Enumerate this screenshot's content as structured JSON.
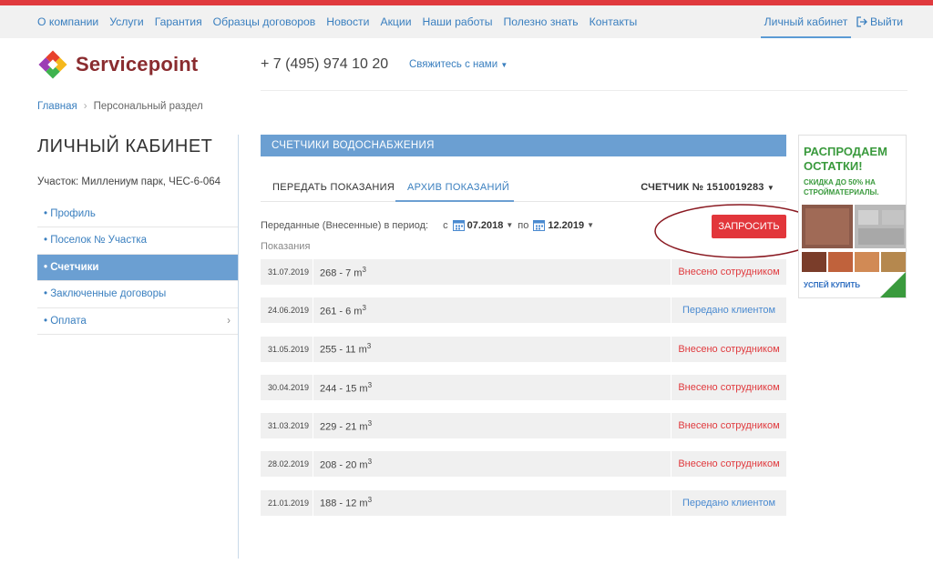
{
  "top_nav": [
    "О компании",
    "Услуги",
    "Гарантия",
    "Образцы договоров",
    "Новости",
    "Акции",
    "Наши работы",
    "Полезно знать",
    "Контакты"
  ],
  "account": {
    "cabinet_label": "Личный кабинет",
    "logout_label": "Выйти"
  },
  "brand": {
    "name": "Servicepoint",
    "phone": "+ 7 (495) 974 10 20",
    "contact_label": "Свяжитесь с нами"
  },
  "breadcrumb": {
    "home": "Главная",
    "current": "Персональный раздел"
  },
  "page_title": "ЛИЧНЫЙ КАБИНЕТ",
  "plot": "Участок: Миллениум парк, ЧЕС-6-064",
  "sidebar": [
    {
      "label": "• Профиль"
    },
    {
      "label": "• Поселок № Участка"
    },
    {
      "label": "• Счетчики"
    },
    {
      "label": "• Заключенные договоры"
    },
    {
      "label": "• Оплата"
    }
  ],
  "section_title": "СЧЕТЧИКИ ВОДОСНАБЖЕНИЯ",
  "tabs": [
    "ПЕРЕДАТЬ ПОКАЗАНИЯ",
    "АРХИВ ПОКАЗАНИЙ"
  ],
  "meter_label": "СЧЕТЧИК № 1510019283",
  "period": {
    "label": "Переданные (Внесенные) в период:",
    "from_prefix": "с",
    "from": "07.2018",
    "to_prefix": "по",
    "to": "12.2019"
  },
  "request_button": "ЗАПРОСИТЬ",
  "readings_label": "Показания",
  "readings": [
    {
      "date": "31.07.2019",
      "value": "268 - 7 m",
      "unit_sup": "3",
      "status": "Внесено сотрудником",
      "kind": "emp"
    },
    {
      "date": "24.06.2019",
      "value": "261 - 6 m",
      "unit_sup": "3",
      "status": "Передано клиентом",
      "kind": "cli"
    },
    {
      "date": "31.05.2019",
      "value": "255 - 11 m",
      "unit_sup": "3",
      "status": "Внесено сотрудником",
      "kind": "emp"
    },
    {
      "date": "30.04.2019",
      "value": "244 - 15 m",
      "unit_sup": "3",
      "status": "Внесено сотрудником",
      "kind": "emp"
    },
    {
      "date": "31.03.2019",
      "value": "229 - 21 m",
      "unit_sup": "3",
      "status": "Внесено сотрудником",
      "kind": "emp"
    },
    {
      "date": "28.02.2019",
      "value": "208 - 20 m",
      "unit_sup": "3",
      "status": "Внесено сотрудником",
      "kind": "emp"
    },
    {
      "date": "21.01.2019",
      "value": "188 - 12 m",
      "unit_sup": "3",
      "status": "Передано клиентом",
      "kind": "cli"
    }
  ],
  "banner": {
    "headline": "РАСПРОДАЕМ ОСТАТКИ!",
    "subline": "СКИДКА ДО 50% НА СТРОЙМАТЕРИАЛЫ.",
    "cta": "УСПЕЙ КУПИТЬ"
  },
  "colors": {
    "accent_red": "#e2363b",
    "nav_blue": "#3a7fbf",
    "panel_blue": "#6b9fd2",
    "employee_status": "#e03a3e",
    "client_status": "#4a8ad0",
    "annotation": "#8a1a22"
  }
}
